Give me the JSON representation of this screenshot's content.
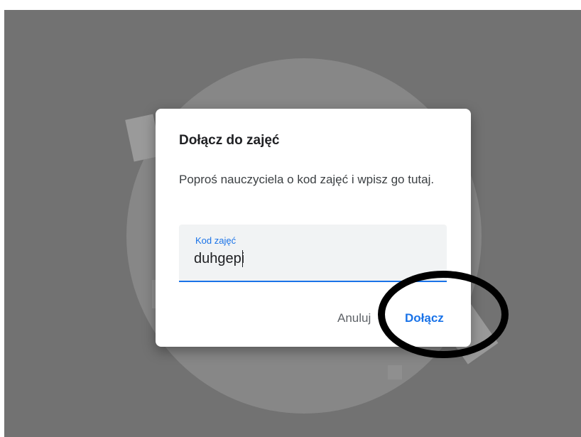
{
  "dialog": {
    "title": "Dołącz do zajęć",
    "description": "Poproś nauczyciela o kod zajęć i wpisz go tutaj.",
    "field": {
      "label": "Kod zajęć",
      "value": "duhgepi"
    },
    "buttons": {
      "cancel": "Anuluj",
      "join": "Dołącz"
    }
  },
  "colors": {
    "accent": "#1a73e8",
    "overlay": "#727272",
    "annotation": "#000000"
  }
}
